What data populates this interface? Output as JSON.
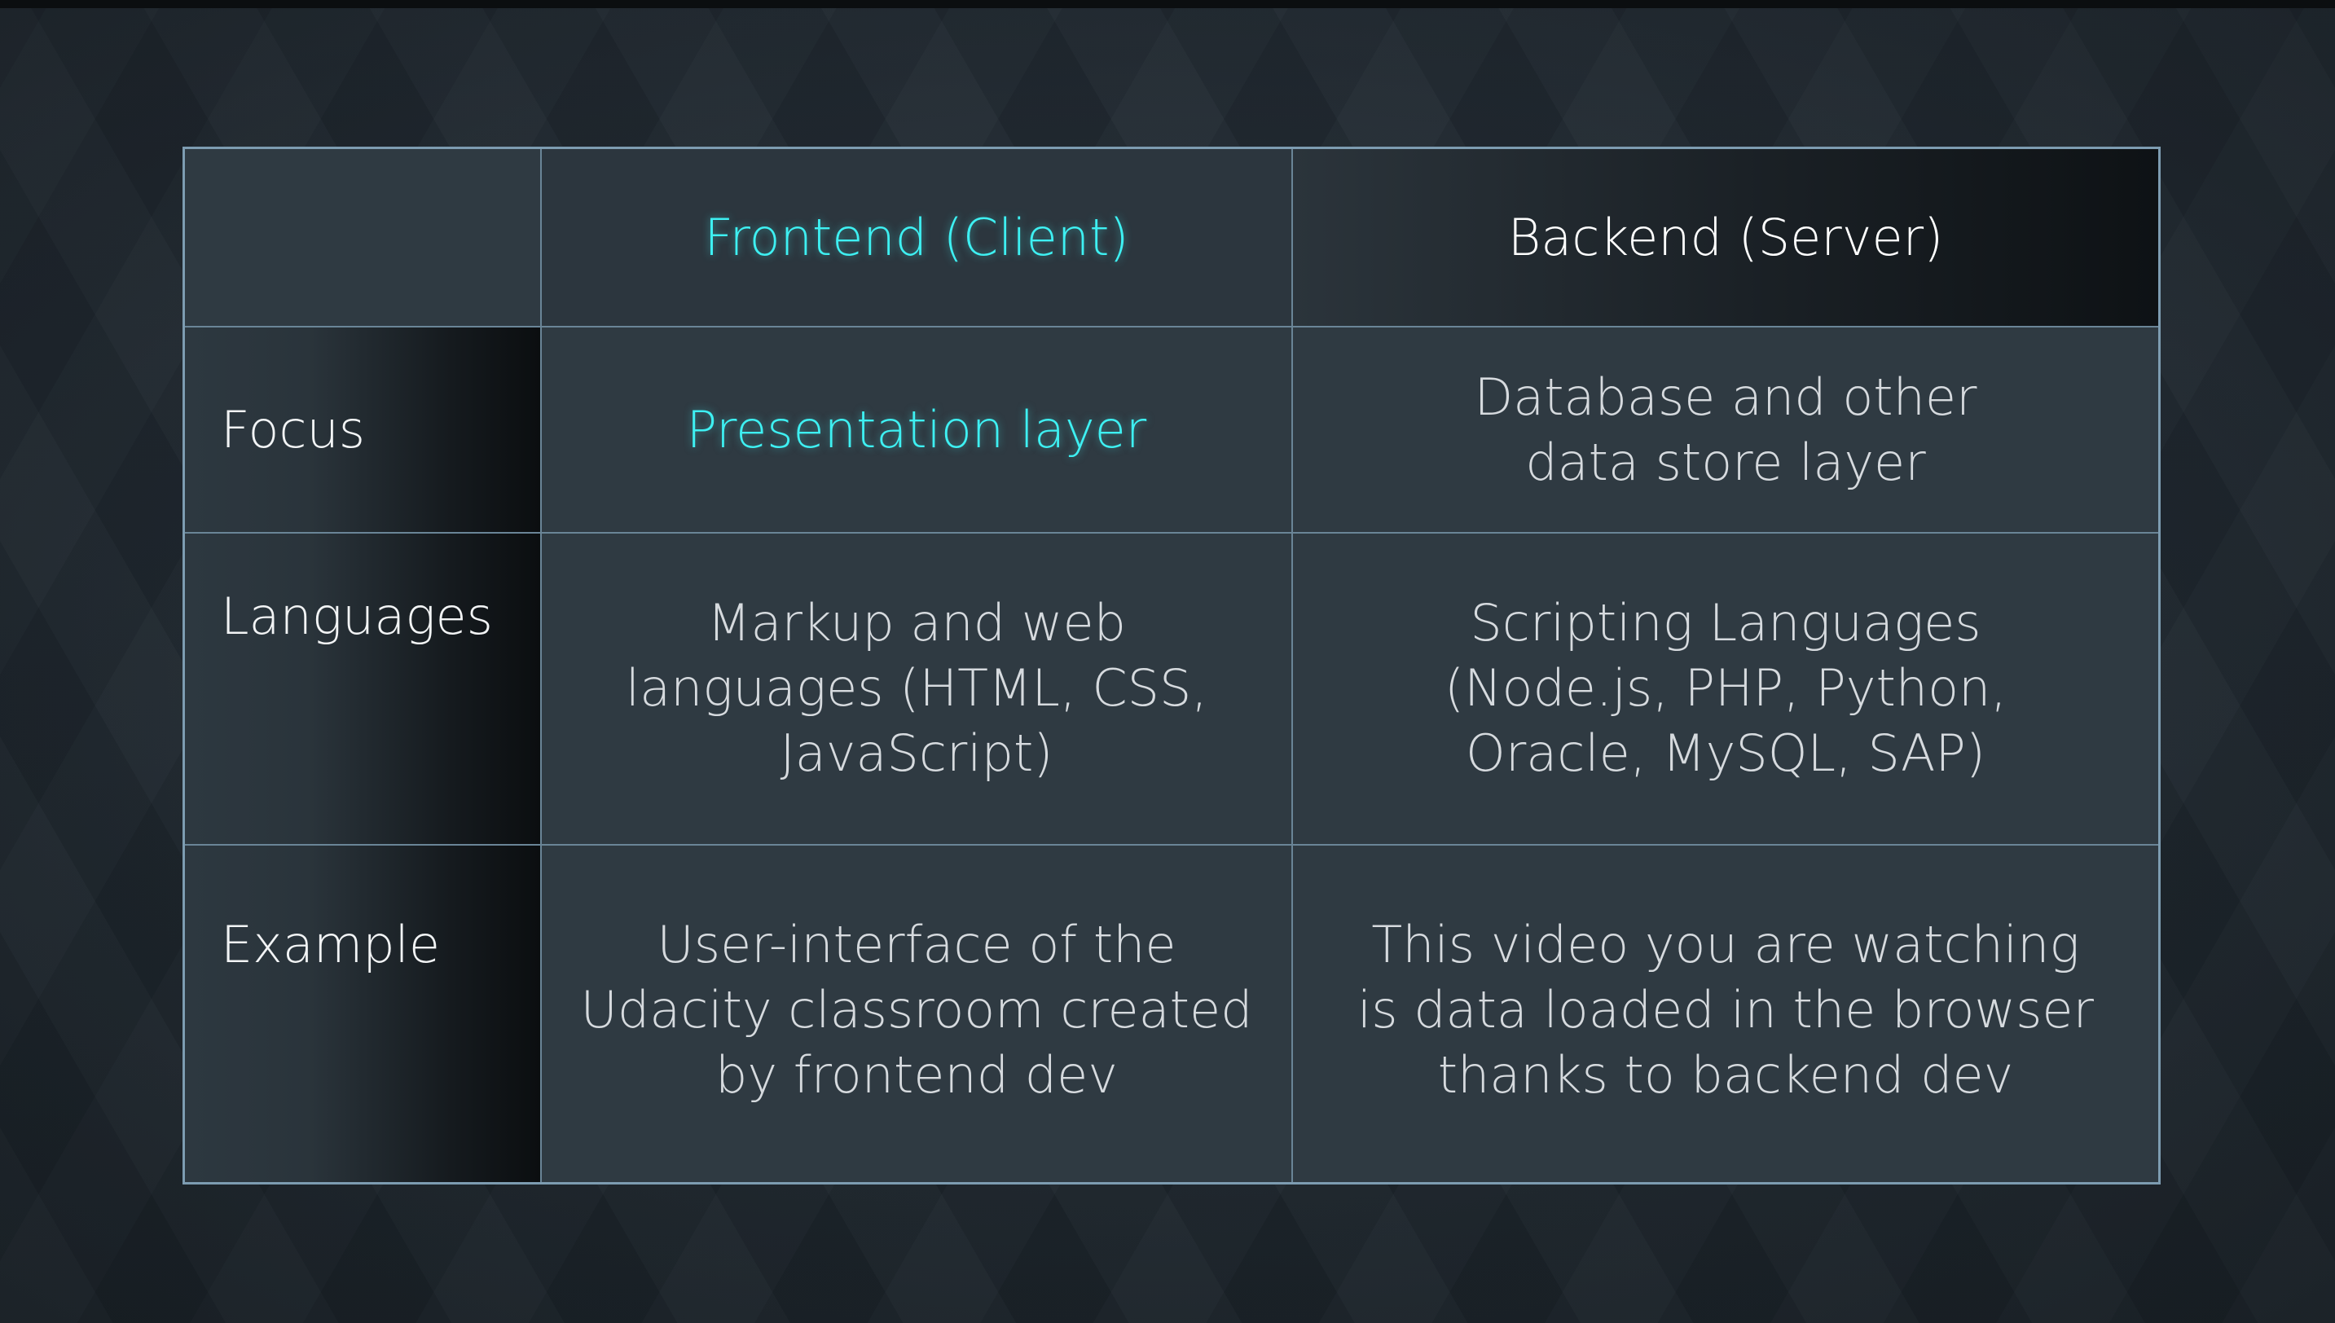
{
  "table": {
    "columns": [
      "",
      "Frontend (Client)",
      "Backend (Server)"
    ],
    "rows": [
      {
        "label": "Focus",
        "frontend": "Presentation layer",
        "backend": "Database and other\ndata store layer"
      },
      {
        "label": "Languages",
        "frontend": "Markup and web\nlanguages (HTML, CSS,\nJavaScript)",
        "backend": "Scripting Languages\n(Node.js, PHP, Python,\nOracle, MySQL, SAP)"
      },
      {
        "label": "Example",
        "frontend": "User-interface of the\nUdacity classroom created\nby frontend dev",
        "backend": "This video you are watching\nis data loaded in the browser\nthanks to  backend dev"
      }
    ]
  },
  "colors": {
    "accent": "#3ef0f2",
    "border": "#7d9cb1",
    "cell_bg": "#2f3a42",
    "text": "#d6dade"
  }
}
